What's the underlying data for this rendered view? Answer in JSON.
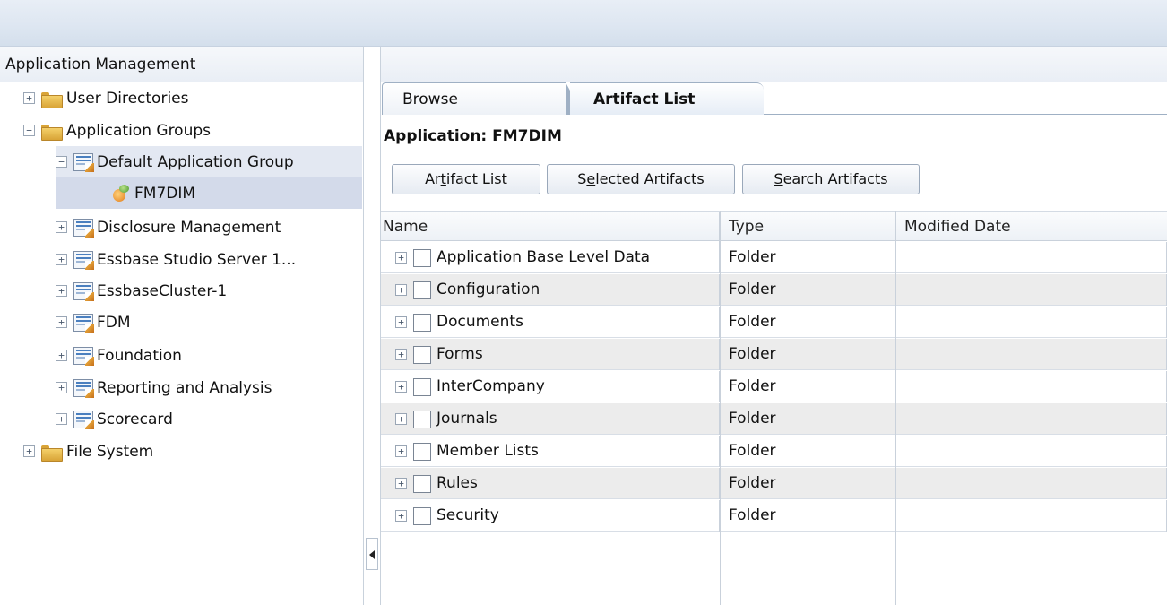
{
  "left_panel": {
    "header": "Application Management",
    "tree": [
      {
        "label": "User Directories",
        "expander": "+",
        "icon": "folder-icon"
      },
      {
        "label": "Application Groups",
        "expander": "−",
        "icon": "folder-icon"
      },
      {
        "label": "Default Application Group",
        "expander": "−",
        "icon": "application-group-icon"
      },
      {
        "label": "FM7DIM",
        "expander": "",
        "icon": "application-icon"
      },
      {
        "label": "Disclosure Management",
        "expander": "+",
        "icon": "application-group-icon"
      },
      {
        "label": "Essbase Studio Server 1...",
        "expander": "+",
        "icon": "application-group-icon"
      },
      {
        "label": "EssbaseCluster-1",
        "expander": "+",
        "icon": "application-group-icon"
      },
      {
        "label": "FDM",
        "expander": "+",
        "icon": "application-group-icon"
      },
      {
        "label": "Foundation",
        "expander": "+",
        "icon": "application-group-icon"
      },
      {
        "label": "Reporting and Analysis",
        "expander": "+",
        "icon": "application-group-icon"
      },
      {
        "label": "Scorecard",
        "expander": "+",
        "icon": "application-group-icon"
      },
      {
        "label": "File System",
        "expander": "+",
        "icon": "folder-icon"
      }
    ]
  },
  "tabs": {
    "browse": "Browse",
    "artifact_list": "Artifact List"
  },
  "application_title": "Application: FM7DIM",
  "buttons": {
    "artifact_list": {
      "pre": "Ar",
      "ul": "t",
      "post": "ifact List"
    },
    "selected_artifacts": {
      "pre": "S",
      "ul": "e",
      "post": "lected Artifacts"
    },
    "search_artifacts": {
      "pre": "",
      "ul": "S",
      "post": "earch Artifacts"
    }
  },
  "grid": {
    "columns": [
      "Name",
      "Type",
      "Modified Date"
    ],
    "rows": [
      {
        "name": "Application Base Level Data",
        "type": "Folder",
        "modified": ""
      },
      {
        "name": "Configuration",
        "type": "Folder",
        "modified": ""
      },
      {
        "name": "Documents",
        "type": "Folder",
        "modified": ""
      },
      {
        "name": "Forms",
        "type": "Folder",
        "modified": ""
      },
      {
        "name": "InterCompany",
        "type": "Folder",
        "modified": ""
      },
      {
        "name": "Journals",
        "type": "Folder",
        "modified": ""
      },
      {
        "name": "Member Lists",
        "type": "Folder",
        "modified": ""
      },
      {
        "name": "Rules",
        "type": "Folder",
        "modified": ""
      },
      {
        "name": "Security",
        "type": "Folder",
        "modified": ""
      }
    ],
    "row_expander": "+"
  }
}
